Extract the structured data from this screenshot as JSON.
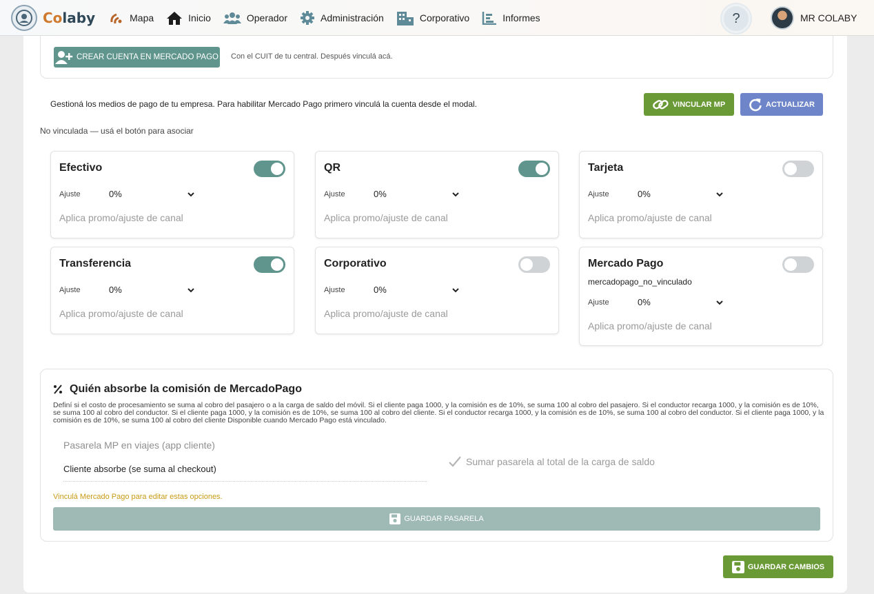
{
  "brand": {
    "name_first": "Co",
    "name_rest": "laby"
  },
  "nav": [
    {
      "label": "Mapa",
      "icon": "map-icon"
    },
    {
      "label": "Inicio",
      "icon": "home-icon"
    },
    {
      "label": "Operador",
      "icon": "users-icon"
    },
    {
      "label": "Administración",
      "icon": "gear-icon"
    },
    {
      "label": "Corporativo",
      "icon": "building-icon"
    },
    {
      "label": "Informes",
      "icon": "chart-icon"
    }
  ],
  "help": {
    "label": "?"
  },
  "user": {
    "name": "MR COLABY"
  },
  "mp_account": {
    "create_label": "CREAR CUENTA EN MERCADO PAGO",
    "hint": "Con el CUIT de tu central. Después vinculá acá."
  },
  "intro": "Gestioná los medios de pago de tu empresa. Para habilitar Mercado Pago primero vinculá la cuenta desde el modal.",
  "actions": {
    "vincular": "VINCULAR MP",
    "actualizar": "ACTUALIZAR"
  },
  "status": "No vinculada — usá el botón para asociar",
  "methods": [
    {
      "title": "Efectivo",
      "enabled": true,
      "adjust_label": "Ajuste",
      "adjust_value": "0%",
      "promo": "Aplica promo/ajuste de canal"
    },
    {
      "title": "QR",
      "enabled": true,
      "adjust_label": "Ajuste",
      "adjust_value": "0%",
      "promo": "Aplica promo/ajuste de canal"
    },
    {
      "title": "Tarjeta",
      "enabled": false,
      "adjust_label": "Ajuste",
      "adjust_value": "0%",
      "promo": "Aplica promo/ajuste de canal"
    },
    {
      "title": "Transferencia",
      "enabled": true,
      "adjust_label": "Ajuste",
      "adjust_value": "0%",
      "promo": "Aplica promo/ajuste de canal"
    },
    {
      "title": "Corporativo",
      "enabled": false,
      "adjust_label": "Ajuste",
      "adjust_value": "0%",
      "promo": "Aplica promo/ajuste de canal"
    },
    {
      "title": "Mercado Pago",
      "enabled": false,
      "subtitle": "mercadopago_no_vinculado",
      "adjust_label": "Ajuste",
      "adjust_value": "0%",
      "promo": "Aplica promo/ajuste de canal"
    }
  ],
  "commission": {
    "title": "Quién absorbe la comisión de MercadoPago",
    "description": "Definí si el costo de procesamiento se suma al cobro del pasajero o a la carga de saldo del móvil. Si el cliente paga 1000, y la comisión es de 10%, se suma 100 al cobro del pasajero. Si el conductor recarga 1000, y la comisión es de 10%, se suma 100 al cobro del conductor. Si el cliente paga 1000, y la comisión es de 10%, se suma 100 al cobro del cliente. Si el conductor recarga 1000, y la comisión es de 10%, se suma 100 al cobro del conductor. Si el cliente paga 1000, y la comisión es de 10%, se suma 100 al cobro del cliente Disponible cuando Mercado Pago está vinculado.",
    "pasarela_label": "Pasarela MP en viajes (app cliente)",
    "pasarela_value": "Cliente absorbe (se suma al checkout)",
    "sumar_label": "Sumar pasarela al total de la carga de saldo",
    "warning": "Vinculá Mercado Pago para editar estas opciones.",
    "save_label": "GUARDAR PASARELA"
  },
  "save_all": "GUARDAR CAMBIOS"
}
